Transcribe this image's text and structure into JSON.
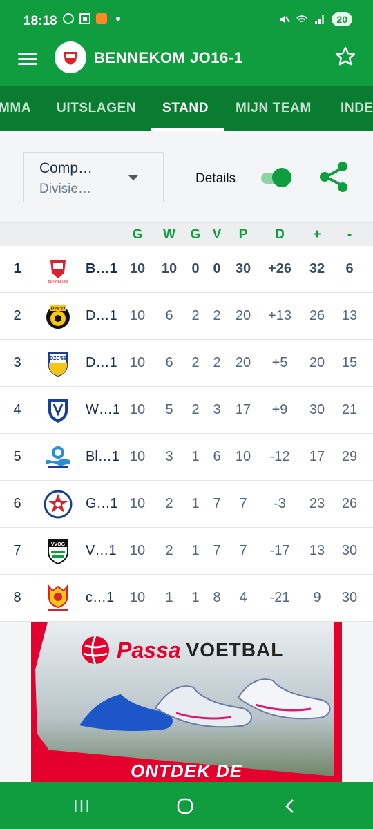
{
  "status_bar": {
    "time": "18:18",
    "battery": "20",
    "icons_left": [
      "whatsapp-icon",
      "scan-icon",
      "app-icon",
      "dot-icon"
    ],
    "icons_right": [
      "mute-icon",
      "wifi-icon",
      "signal-icon"
    ]
  },
  "app_bar": {
    "title": "BENNEKOM JO16-1",
    "menu_icon": "hamburger-icon",
    "favorite_icon": "star-icon"
  },
  "tabs": [
    {
      "label": "MMA",
      "active": false
    },
    {
      "label": "UITSLAGEN",
      "active": false
    },
    {
      "label": "STAND",
      "active": true
    },
    {
      "label": "MIJN TEAM",
      "active": false
    },
    {
      "label": "INDE",
      "active": false
    }
  ],
  "controls": {
    "competition_title": "Comp…",
    "competition_sub": "Divisie…",
    "details_label": "Details",
    "details_on": true
  },
  "table": {
    "headers": [
      "G",
      "W",
      "G",
      "V",
      "P",
      "D",
      "+",
      "-"
    ],
    "rows": [
      {
        "pos": "1",
        "team": "B…1",
        "g": "10",
        "w": "10",
        "d": "0",
        "v": "0",
        "p": "30",
        "diff": "+26",
        "plus": "32",
        "minus": "6",
        "highlight": true,
        "logo": "bennekom-logo"
      },
      {
        "pos": "2",
        "team": "D…1",
        "g": "10",
        "w": "6",
        "d": "2",
        "v": "2",
        "p": "20",
        "diff": "+13",
        "plus": "26",
        "minus": "13",
        "highlight": false,
        "logo": "dvs33-logo"
      },
      {
        "pos": "3",
        "team": "D…1",
        "g": "10",
        "w": "6",
        "d": "2",
        "v": "2",
        "p": "20",
        "diff": "+5",
        "plus": "20",
        "minus": "15",
        "highlight": false,
        "logo": "dzc68-logo"
      },
      {
        "pos": "4",
        "team": "W…1",
        "g": "10",
        "w": "5",
        "d": "2",
        "v": "3",
        "p": "17",
        "diff": "+9",
        "plus": "30",
        "minus": "21",
        "highlight": false,
        "logo": "w-shield-logo"
      },
      {
        "pos": "5",
        "team": "Bl…1",
        "g": "10",
        "w": "3",
        "d": "1",
        "v": "6",
        "p": "10",
        "diff": "-12",
        "plus": "17",
        "minus": "29",
        "highlight": false,
        "logo": "blauw-logo"
      },
      {
        "pos": "6",
        "team": "G…1",
        "g": "10",
        "w": "2",
        "d": "1",
        "v": "7",
        "p": "7",
        "diff": "-3",
        "plus": "23",
        "minus": "26",
        "highlight": false,
        "logo": "g-star-logo"
      },
      {
        "pos": "7",
        "team": "V…1",
        "g": "10",
        "w": "2",
        "d": "1",
        "v": "7",
        "p": "7",
        "diff": "-17",
        "plus": "13",
        "minus": "30",
        "highlight": false,
        "logo": "vvog-logo"
      },
      {
        "pos": "8",
        "team": "c…1",
        "g": "10",
        "w": "1",
        "d": "1",
        "v": "8",
        "p": "4",
        "diff": "-21",
        "plus": "9",
        "minus": "30",
        "highlight": false,
        "logo": "csv-apeldoorn-logo"
      }
    ]
  },
  "ad": {
    "brand": "Passa",
    "brand2": "VOETBAL",
    "cta": "ONTDEK DE"
  },
  "colors": {
    "primary": "#0f9d3f",
    "tab_bg": "#0a7c31",
    "ad_red": "#e3002c"
  }
}
